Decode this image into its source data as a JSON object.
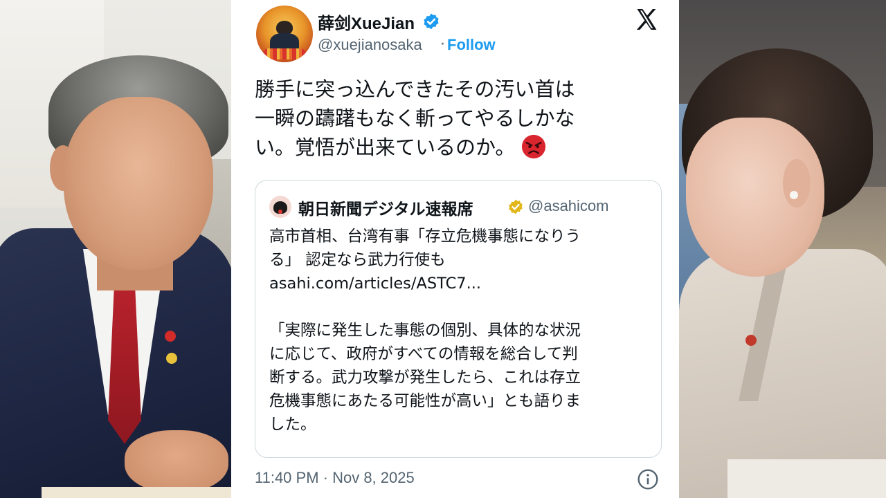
{
  "tweet": {
    "display_name": "薛剑XueJian",
    "handle": "@xuejianosaka",
    "separator": "·",
    "follow_label": "Follow",
    "text_lines": [
      "勝手に突っ込んできたその汚い首は",
      "一瞬の躊躇もなく斬ってやるしかな",
      "い。覚悟が出来ているのか。"
    ],
    "emoji": "angry-face",
    "timestamp": "11:40 PM · Nov 8, 2025"
  },
  "quote": {
    "name": "朝日新聞デジタル速報席",
    "handle": "@asahicom",
    "lines": [
      "高市首相、台湾有事「存立危機事態になりう",
      "る」 認定なら武力行使も",
      "asahi.com/articles/ASTC7...",
      "",
      "「実際に発生した事態の個別、具体的な状況",
      "に応じて、政府がすべての情報を総合して判",
      "断する。武力攻撃が発生したら、これは存立",
      "危機事態にあたる可能性が高い」とも語りま",
      "した。"
    ]
  },
  "icons": {
    "verified": "verified-badge-icon",
    "gold_badge": "gold-verified-badge-icon",
    "platform_logo": "x-logo-icon",
    "info": "info-icon",
    "emoji": "angry-face-icon"
  },
  "colors": {
    "link_blue": "#1d9bf0",
    "text": "#0f1419",
    "muted": "#536471",
    "gold": "#e2b719",
    "border": "#cfd9de"
  }
}
